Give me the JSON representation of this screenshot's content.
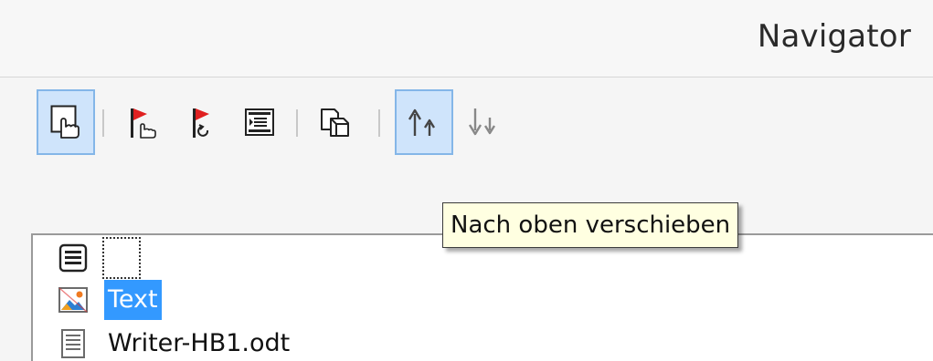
{
  "window": {
    "title": "Navigator"
  },
  "toolbar": {
    "buttons": [
      {
        "icon": "content-navigation-view-icon",
        "pressed": true
      },
      {
        "icon": "set-reminder-icon",
        "pressed": false
      },
      {
        "icon": "reminder-return-icon",
        "pressed": false
      },
      {
        "icon": "header-footer-icon",
        "pressed": false
      },
      {
        "icon": "drag-mode-icon",
        "pressed": false
      },
      {
        "icon": "promote-chapter-icon",
        "pressed": true
      },
      {
        "icon": "demote-chapter-icon",
        "pressed": false
      }
    ]
  },
  "tooltip": {
    "text": "Nach oben verschieben"
  },
  "tree": {
    "items": [
      {
        "icon": "headings-icon",
        "label": "",
        "focused": true
      },
      {
        "icon": "image-icon",
        "label": "Text",
        "selected": true
      },
      {
        "icon": "document-icon",
        "label": "Writer-HB1.odt",
        "selected": false
      }
    ]
  },
  "colors": {
    "accent": "#3399ff",
    "pressed_bg": "#cfe4fb",
    "pressed_border": "#84b6e8",
    "tooltip_bg": "#ffffe1",
    "flag_red": "#e02020"
  }
}
